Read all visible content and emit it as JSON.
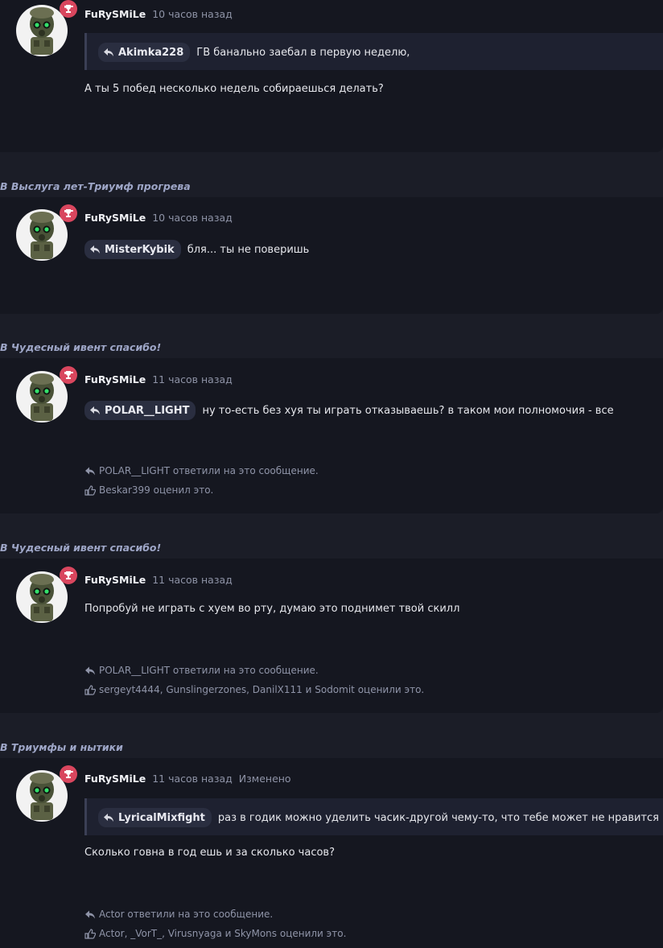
{
  "avatar_desc_colors": {
    "ring": "#f2f2f2",
    "badge": "#d9465e",
    "mask": "#4a5238",
    "eyes": "#33e06a"
  },
  "posts": [
    {
      "thread": "",
      "user": "FuRySMiLe",
      "time": "10 часов назад",
      "edited": "",
      "quote_user": "Akimka228",
      "quote_text": "ГВ банально заебал в первую неделю,",
      "body": "А ты 5 побед несколько недель собираешься делать?",
      "replies": "",
      "likes": ""
    },
    {
      "thread_prefix": "В",
      "thread": "Выслуга лет-Триумф прогрева",
      "user": "FuRySMiLe",
      "time": "10 часов назад",
      "edited": "",
      "mention_user": "MisterKybik",
      "mention_text": "бля... ты не поверишь",
      "replies": "",
      "likes": ""
    },
    {
      "thread_prefix": "В",
      "thread": "Чудесный ивент спасибо!",
      "user": "FuRySMiLe",
      "time": "11 часов назад",
      "edited": "",
      "mention_user": "POLAR__LIGHT",
      "mention_text": "ну то-есть без хуя ты играть отказываешь? в таком мои полномочия - все",
      "replies": "POLAR__LIGHT ответили на это сообщение.",
      "likes": "Beskar399 оценил это."
    },
    {
      "thread_prefix": "В",
      "thread": "Чудесный ивент спасибо!",
      "user": "FuRySMiLe",
      "time": "11 часов назад",
      "edited": "",
      "body": "Попробуй не играть с хуем во рту, думаю это поднимет твой скилл",
      "replies": "POLAR__LIGHT ответили на это сообщение.",
      "likes": "sergeyt4444, Gunslingerzones, DanilX111 и Sodomit оценили это."
    },
    {
      "thread_prefix": "В",
      "thread": "Триумфы и нытики",
      "user": "FuRySMiLe",
      "time": "11 часов назад",
      "edited": "Изменено",
      "quote_user": "LyricalMixfight",
      "quote_text": "раз в годик можно уделить часик-другой чему-то, что тебе может не нравится",
      "body": "Сколько говна в год ешь и за сколько часов?",
      "replies": "Actor ответили на это сообщение.",
      "likes": "Actor, _VorT_, Virusnyaga и SkyMons оценили это."
    }
  ]
}
